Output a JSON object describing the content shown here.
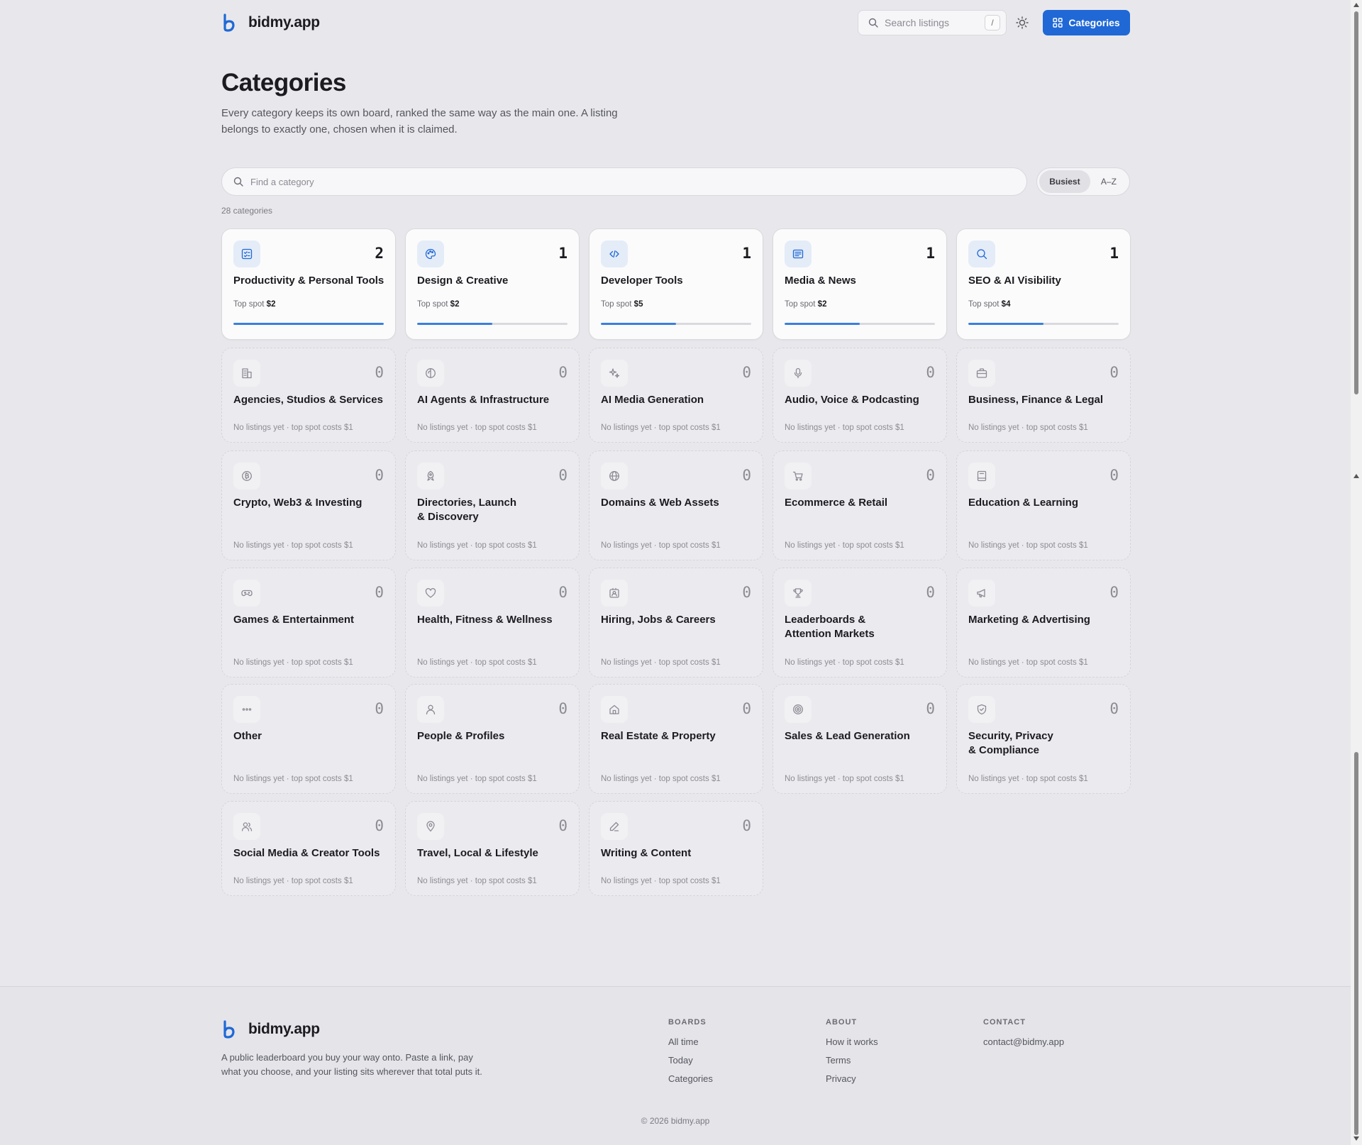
{
  "brand": {
    "name": "bidmy.app",
    "accent": "#1f68d6"
  },
  "header": {
    "search_placeholder": "Search listings",
    "search_shortcut": "/",
    "categories_button": "Categories"
  },
  "hero": {
    "title": "Categories",
    "subtitle": "Every category keeps its own board, ranked the same way as the main one. A listing belongs to exactly one, chosen when it is claimed."
  },
  "filter": {
    "placeholder": "Find a category",
    "sort_options": [
      "Busiest",
      "A–Z"
    ],
    "sort_selected": "Busiest",
    "count_label": "28 categories"
  },
  "cards": [
    {
      "name": "Productivity & Personal Tools",
      "count": "2",
      "icon": "checklist-icon",
      "active": true,
      "top_spot_label": "Top spot",
      "top_spot_price": "$2",
      "bar_fraction": 1.0
    },
    {
      "name": "Design & Creative",
      "count": "1",
      "icon": "palette-icon",
      "active": true,
      "top_spot_label": "Top spot",
      "top_spot_price": "$2",
      "bar_fraction": 0.5
    },
    {
      "name": "Developer Tools",
      "count": "1",
      "icon": "code-icon",
      "active": true,
      "top_spot_label": "Top spot",
      "top_spot_price": "$5",
      "bar_fraction": 0.5
    },
    {
      "name": "Media & News",
      "count": "1",
      "icon": "newspaper-icon",
      "active": true,
      "top_spot_label": "Top spot",
      "top_spot_price": "$2",
      "bar_fraction": 0.5
    },
    {
      "name": "SEO & AI Visibility",
      "count": "1",
      "icon": "search-icon",
      "active": true,
      "top_spot_label": "Top spot",
      "top_spot_price": "$4",
      "bar_fraction": 0.5
    },
    {
      "name": "Agencies, Studios & Services",
      "count": "0",
      "icon": "building-icon",
      "active": false,
      "note": "No listings yet · top spot costs $1"
    },
    {
      "name": "AI Agents & Infrastructure",
      "count": "0",
      "icon": "brain-icon",
      "active": false,
      "note": "No listings yet · top spot costs $1"
    },
    {
      "name": "AI Media Generation",
      "count": "0",
      "icon": "sparkles-icon",
      "active": false,
      "note": "No listings yet · top spot costs $1"
    },
    {
      "name": "Audio, Voice & Podcasting",
      "count": "0",
      "icon": "microphone-icon",
      "active": false,
      "note": "No listings yet · top spot costs $1"
    },
    {
      "name": "Business, Finance & Legal",
      "count": "0",
      "icon": "briefcase-icon",
      "active": false,
      "note": "No listings yet · top spot costs $1"
    },
    {
      "name": "Crypto, Web3 & Investing",
      "count": "0",
      "icon": "bitcoin-icon",
      "active": false,
      "note": "No listings yet · top spot costs $1"
    },
    {
      "name": "Directories, Launch & Discovery",
      "name_lines": [
        "Directories, Launch",
        "& Discovery"
      ],
      "count": "0",
      "icon": "rocket-icon",
      "active": false,
      "note": "No listings yet · top spot costs $1"
    },
    {
      "name": "Domains & Web Assets",
      "count": "0",
      "icon": "globe-icon",
      "active": false,
      "note": "No listings yet · top spot costs $1"
    },
    {
      "name": "Ecommerce & Retail",
      "count": "0",
      "icon": "cart-icon",
      "active": false,
      "note": "No listings yet · top spot costs $1"
    },
    {
      "name": "Education & Learning",
      "count": "0",
      "icon": "book-icon",
      "active": false,
      "note": "No listings yet · top spot costs $1"
    },
    {
      "name": "Games & Entertainment",
      "count": "0",
      "icon": "gamepad-icon",
      "active": false,
      "note": "No listings yet · top spot costs $1"
    },
    {
      "name": "Health, Fitness & Wellness",
      "count": "0",
      "icon": "heart-icon",
      "active": false,
      "note": "No listings yet · top spot costs $1"
    },
    {
      "name": "Hiring, Jobs & Careers",
      "count": "0",
      "icon": "id-badge-icon",
      "active": false,
      "note": "No listings yet · top spot costs $1"
    },
    {
      "name": "Leaderboards & Attention Markets",
      "name_lines": [
        "Leaderboards &",
        "Attention Markets"
      ],
      "count": "0",
      "icon": "trophy-icon",
      "active": false,
      "note": "No listings yet · top spot costs $1"
    },
    {
      "name": "Marketing & Advertising",
      "count": "0",
      "icon": "megaphone-icon",
      "active": false,
      "note": "No listings yet · top spot costs $1"
    },
    {
      "name": "Other",
      "count": "0",
      "icon": "ellipsis-icon",
      "active": false,
      "note": "No listings yet · top spot costs $1"
    },
    {
      "name": "People & Profiles",
      "count": "0",
      "icon": "user-icon",
      "active": false,
      "note": "No listings yet · top spot costs $1"
    },
    {
      "name": "Real Estate & Property",
      "count": "0",
      "icon": "home-icon",
      "active": false,
      "note": "No listings yet · top spot costs $1"
    },
    {
      "name": "Sales & Lead Generation",
      "count": "0",
      "icon": "target-icon",
      "active": false,
      "note": "No listings yet · top spot costs $1"
    },
    {
      "name": "Security, Privacy & Compliance",
      "name_lines": [
        "Security, Privacy",
        "& Compliance"
      ],
      "count": "0",
      "icon": "shield-icon",
      "active": false,
      "note": "No listings yet · top spot costs $1"
    },
    {
      "name": "Social Media & Creator Tools",
      "count": "0",
      "icon": "users-icon",
      "active": false,
      "note": "No listings yet · top spot costs $1"
    },
    {
      "name": "Travel, Local & Lifestyle",
      "count": "0",
      "icon": "map-pin-icon",
      "active": false,
      "note": "No listings yet · top spot costs $1"
    },
    {
      "name": "Writing & Content",
      "count": "0",
      "icon": "pen-icon",
      "active": false,
      "note": "No listings yet · top spot costs $1"
    }
  ],
  "footer": {
    "brand": "bidmy.app",
    "description": "A public leaderboard you buy your way onto. Paste a link, pay what you choose, and your listing sits wherever that total puts it.",
    "columns": [
      {
        "heading": "BOARDS",
        "links": [
          "All time",
          "Today",
          "Categories"
        ]
      },
      {
        "heading": "ABOUT",
        "links": [
          "How it works",
          "Terms",
          "Privacy"
        ]
      },
      {
        "heading": "CONTACT",
        "links": [
          "contact@bidmy.app"
        ]
      }
    ],
    "copyright": "© 2026 bidmy.app"
  }
}
